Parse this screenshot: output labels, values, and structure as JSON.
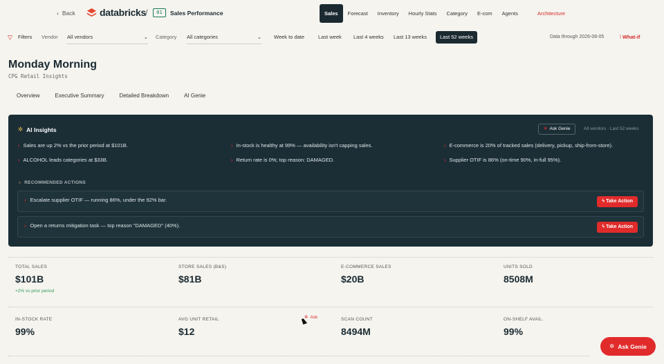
{
  "header": {
    "back_label": "Back",
    "brand": "databricks",
    "separator": "/",
    "dashboard_badge": "01",
    "dashboard_title": "Sales Performance",
    "nav": [
      {
        "label": "Sales",
        "active": true
      },
      {
        "label": "Forecast"
      },
      {
        "label": "Inventory"
      },
      {
        "label": "Hourly Stats"
      },
      {
        "label": "Category"
      },
      {
        "label": "E-com"
      },
      {
        "label": "Agents"
      },
      {
        "label": "Architecture",
        "accent": true
      }
    ]
  },
  "filters": {
    "label": "Filters",
    "vendor_label": "Vendor",
    "vendor_value": "All vendors",
    "category_label": "Category",
    "category_value": "All categories",
    "periods": [
      "Week to date",
      "Last week",
      "Last 4 weeks",
      "Last 13 weeks",
      "Last 52 weeks"
    ],
    "active_period": "Last 52 weeks",
    "data_through": "Data through 2026-08-05",
    "what_if": "What-if"
  },
  "page": {
    "title": "Monday Morning",
    "subtitle": "CPG Retail Insights",
    "tabs": [
      "Overview",
      "Executive Summary",
      "Detailed Breakdown",
      "AI Genie"
    ]
  },
  "ai_insights": {
    "title": "AI Insights",
    "ask_genie": "Ask Genie",
    "scope": "All vendors · Last 52 weeks",
    "insights": [
      "Sales are up 2% vs the prior period at $101B.",
      "In-stock is healthy at 99% — availability isn't capping sales.",
      "E-commerce is 20% of tracked sales (delivery, pickup, ship-from-store).",
      "ALCOHOL leads categories at $33B.",
      "Return rate is 0%; top reason: DAMAGED.",
      "Supplier OTIF is 86% (on-time 90%, in-full 95%)."
    ],
    "recommended_heading": "RECOMMENDED ACTIONS",
    "actions": [
      {
        "text": "Escalate supplier OTIF — running 86%, under the 92% bar.",
        "button": "Take Action"
      },
      {
        "text": "Open a returns mitigation task — top reason \"DAMAGED\" (40%).",
        "button": "Take Action"
      }
    ]
  },
  "kpis": [
    {
      "label": "TOTAL SALES",
      "value": "$101B",
      "delta": "+2% vs prior period"
    },
    {
      "label": "STORE SALES (B&S)",
      "value": "$81B"
    },
    {
      "label": "E-COMMERCE SALES",
      "value": "$20B"
    },
    {
      "label": "UNITS SOLD",
      "value": "8508M"
    },
    {
      "label": "IN-STOCK RATE",
      "value": "99%"
    },
    {
      "label": "AVG UNIT RETAIL",
      "value": "$12"
    },
    {
      "label": "SCAN COUNT",
      "value": "8494M"
    },
    {
      "label": "ON-SHELF AVAIL.",
      "value": "99%"
    }
  ],
  "floating": {
    "ask_label": "Ask",
    "genie_fab": "Ask Genie"
  },
  "colors": {
    "accent": "#e12b2b",
    "dark_panel": "#1b2e36",
    "positive": "#2f9a5a",
    "background": "#f5f4ef"
  }
}
